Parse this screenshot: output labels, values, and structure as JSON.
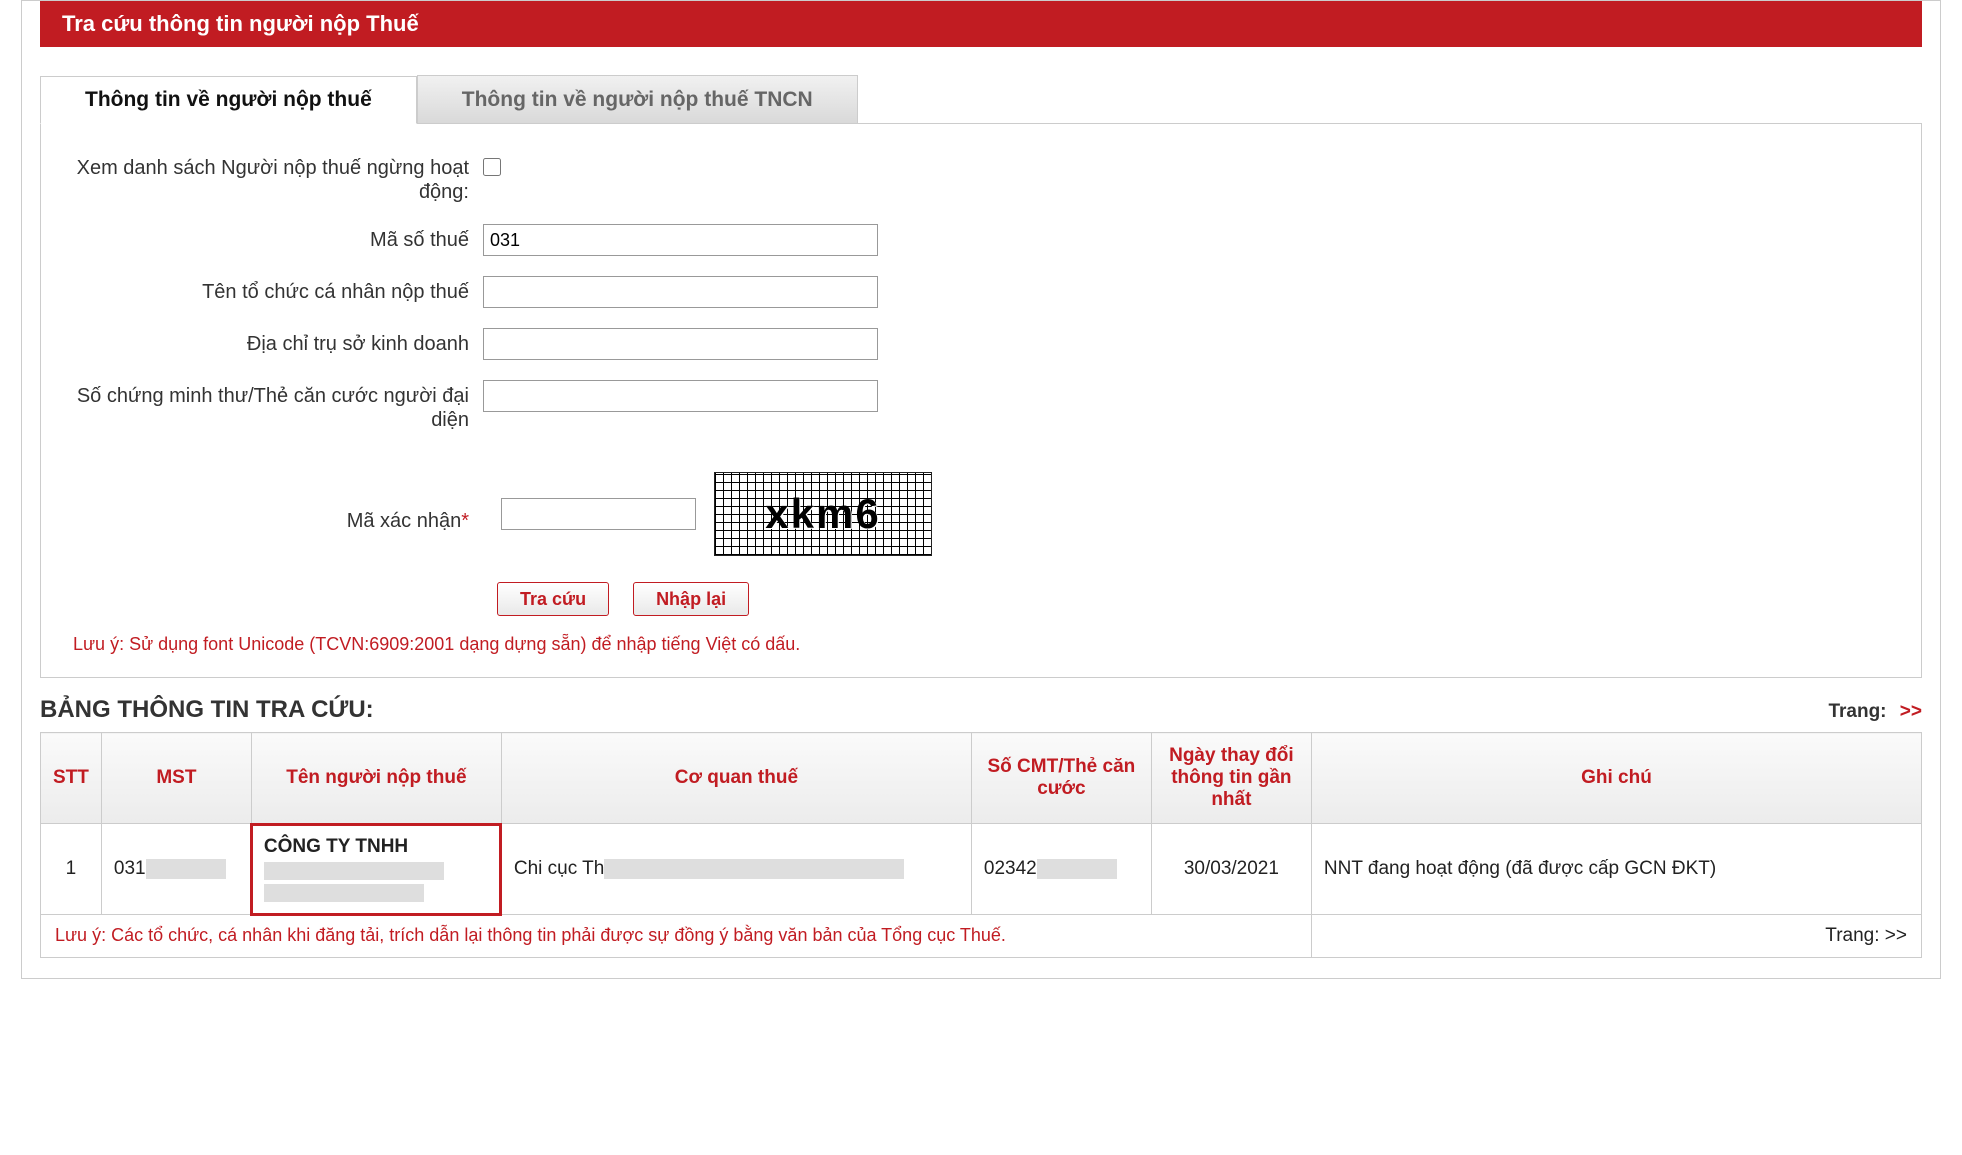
{
  "header": {
    "title": "Tra cứu thông tin người nộp Thuế"
  },
  "tabs": {
    "t1": "Thông tin về người nộp thuế",
    "t2": "Thông tin về người nộp thuế TNCN"
  },
  "form": {
    "labels": {
      "suspended": "Xem danh sách Người nộp thuế ngừng hoạt động:",
      "tax_code": "Mã số thuế",
      "org_name": "Tên tổ chức cá nhân nộp thuế",
      "address": "Địa chỉ trụ sở kinh doanh",
      "id_card": "Số chứng minh thư/Thẻ căn cước người đại diện",
      "captcha": "Mã xác nhận"
    },
    "values": {
      "tax_code": "031",
      "org_name": "",
      "address": "",
      "id_card": "",
      "captcha": ""
    },
    "captcha_text": "xkm6",
    "buttons": {
      "search": "Tra cứu",
      "reset": "Nhập lại"
    },
    "note": "Lưu ý: Sử dụng font Unicode (TCVN:6909:2001 dạng dựng sẵn) để nhập tiếng Việt có dấu."
  },
  "results": {
    "section_title": "BẢNG THÔNG TIN TRA CỨU:",
    "pager_label": "Trang:",
    "pager_arrow": ">>",
    "headers": {
      "stt": "STT",
      "mst": "MST",
      "name": "Tên người nộp thuế",
      "agency": "Cơ quan thuế",
      "id": "Số CMT/Thẻ căn cước",
      "date": "Ngày thay đổi thông tin gần nhất",
      "note": "Ghi chú"
    },
    "rows": [
      {
        "stt": "1",
        "mst": "031",
        "name_line1": "CÔNG TY TNHH",
        "agency_prefix": "Chi cục Th",
        "id_prefix": "02342",
        "date": "30/03/2021",
        "note": "NNT đang hoạt động (đã được cấp GCN ĐKT)"
      }
    ],
    "footer_note": "Lưu ý: Các tổ chức, cá nhân khi đăng tải, trích dẫn lại thông tin phải được sự đồng ý bằng văn bản của Tổng cục Thuế."
  }
}
